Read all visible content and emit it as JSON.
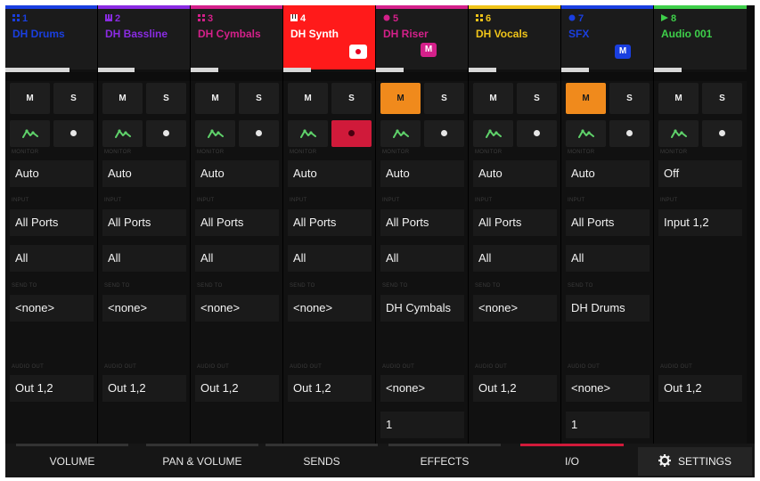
{
  "colors": {
    "record_header": "#ff1a1a",
    "mute_active": "#f08a1c",
    "active_tab_indicator": "#d01a3a",
    "badge_magenta": "#d4208a",
    "badge_blue": "#1a3fe0"
  },
  "labels": {
    "mute": "M",
    "solo": "S"
  },
  "tracks": [
    {
      "number": "1",
      "name": "DH Drums",
      "name_color": "#1a3fe0",
      "bar_color": "#1a3fe0",
      "type_icon": "drum-grid-icon",
      "level": 0.7,
      "mute_on": false,
      "rec_on": false,
      "monitor_label": "MONITOR",
      "monitor": "Auto",
      "input_label": "INPUT",
      "input": "All Ports",
      "channel": "All",
      "sends_label": "SEND TO",
      "sends": "<none>",
      "audio_out_label": "AUDIO OUT",
      "audio_out": "Out 1,2",
      "extra": ""
    },
    {
      "number": "2",
      "name": "DH Bassline",
      "name_color": "#8a2be2",
      "bar_color": "#8a2be2",
      "type_icon": "keys-icon",
      "level": 0.4,
      "mute_on": false,
      "rec_on": false,
      "monitor_label": "MONITOR",
      "monitor": "Auto",
      "input_label": "INPUT",
      "input": "All Ports",
      "channel": "All",
      "sends_label": "SEND TO",
      "sends": "<none>",
      "audio_out_label": "AUDIO OUT",
      "audio_out": "Out 1,2",
      "extra": ""
    },
    {
      "number": "3",
      "name": "DH Cymbals",
      "name_color": "#d4208a",
      "bar_color": "#d4208a",
      "type_icon": "drum-grid-icon",
      "level": 0.3,
      "mute_on": false,
      "rec_on": false,
      "monitor_label": "MONITOR",
      "monitor": "Auto",
      "input_label": "INPUT",
      "input": "All Ports",
      "channel": "All",
      "sends_label": "SEND TO",
      "sends": "<none>",
      "audio_out_label": "AUDIO OUT",
      "audio_out": "Out 1,2",
      "extra": ""
    },
    {
      "number": "4",
      "name": "DH Synth",
      "name_color": "#ffffff",
      "bar_color": "#ff1a1a",
      "type_icon": "keys-icon",
      "level": 0.3,
      "mute_on": false,
      "rec_on": true,
      "monitor_label": "MONITOR",
      "monitor": "Auto",
      "input_label": "INPUT",
      "input": "All Ports",
      "channel": "All",
      "sends_label": "SEND TO",
      "sends": "<none>",
      "audio_out_label": "AUDIO OUT",
      "audio_out": "Out 1,2",
      "extra": ""
    },
    {
      "number": "5",
      "name": "DH Riser",
      "name_color": "#d4208a",
      "bar_color": "#d4208a",
      "type_icon": "plugin-icon",
      "level": 0.3,
      "mute_on": true,
      "rec_on": false,
      "monitor_label": "MONITOR",
      "monitor": "Auto",
      "input_label": "INPUT",
      "input": "All Ports",
      "channel": "All",
      "sends_label": "SEND TO",
      "sends": "DH Cymbals",
      "audio_out_label": "AUDIO OUT",
      "audio_out": "<none>",
      "extra": "1",
      "badge": "M",
      "badge_color": "#d4208a"
    },
    {
      "number": "6",
      "name": "DH Vocals",
      "name_color": "#f0c419",
      "bar_color": "#f0c419",
      "type_icon": "drum-grid-icon",
      "level": 0.3,
      "mute_on": false,
      "rec_on": false,
      "monitor_label": "MONITOR",
      "monitor": "Auto",
      "input_label": "INPUT",
      "input": "All Ports",
      "channel": "All",
      "sends_label": "SEND TO",
      "sends": "<none>",
      "audio_out_label": "AUDIO OUT",
      "audio_out": "Out 1,2",
      "extra": ""
    },
    {
      "number": "7",
      "name": "SFX",
      "name_color": "#1a3fe0",
      "bar_color": "#1a3fe0",
      "type_icon": "plugin-icon",
      "level": 0.3,
      "mute_on": true,
      "rec_on": false,
      "monitor_label": "MONITOR",
      "monitor": "Auto",
      "input_label": "INPUT",
      "input": "All Ports",
      "channel": "All",
      "sends_label": "SEND TO",
      "sends": "DH Drums",
      "audio_out_label": "AUDIO OUT",
      "audio_out": "<none>",
      "extra": "1",
      "badge": "M",
      "badge_color": "#1a3fe0"
    },
    {
      "number": "8",
      "name": "Audio 001",
      "name_color": "#3ecf4a",
      "bar_color": "#3ecf4a",
      "type_icon": "audio-play-icon",
      "level": 0.3,
      "mute_on": false,
      "rec_on": false,
      "monitor_label": "MONITOR",
      "monitor": "Off",
      "input_label": "INPUT",
      "input": "Input 1,2",
      "channel": "",
      "sends_label": "",
      "sends": "",
      "audio_out_label": "AUDIO OUT",
      "audio_out": "Out 1,2",
      "extra": ""
    }
  ],
  "tabs": [
    {
      "label": "VOLUME",
      "active": false
    },
    {
      "label": "PAN & VOLUME",
      "active": false
    },
    {
      "label": "SENDS",
      "active": false
    },
    {
      "label": "EFFECTS",
      "active": false
    },
    {
      "label": "I/O",
      "active": true
    }
  ],
  "settings": {
    "label": "SETTINGS",
    "icon": "gear-icon"
  }
}
